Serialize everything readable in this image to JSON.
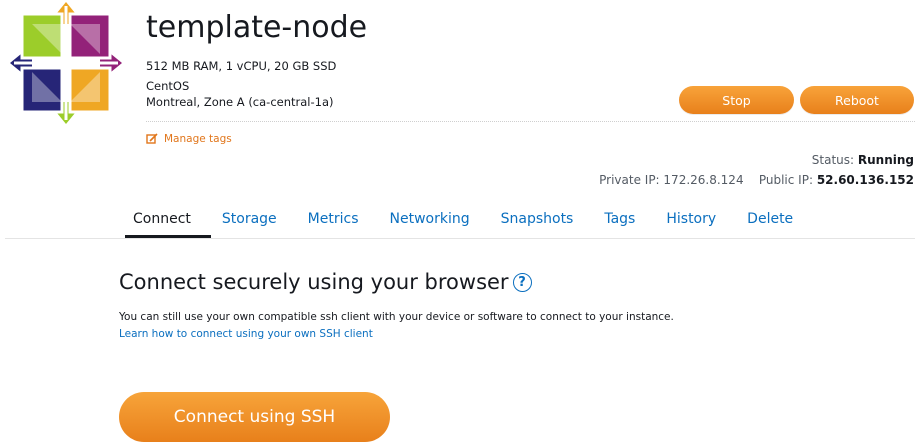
{
  "instance": {
    "name": "template-node",
    "specs": "512 MB RAM, 1 vCPU, 20 GB SSD",
    "os": "CentOS",
    "location": "Montreal, Zone A (ca-central-1a)"
  },
  "actions": {
    "stop_label": "Stop",
    "reboot_label": "Reboot"
  },
  "manage_tags": {
    "label": "Manage tags",
    "icon": "edit-icon"
  },
  "status": {
    "label": "Status:",
    "value": "Running",
    "private_ip_label": "Private IP:",
    "private_ip": "172.26.8.124",
    "public_ip_label": "Public IP:",
    "public_ip": "52.60.136.152"
  },
  "tabs": [
    {
      "label": "Connect",
      "active": true
    },
    {
      "label": "Storage"
    },
    {
      "label": "Metrics"
    },
    {
      "label": "Networking"
    },
    {
      "label": "Snapshots"
    },
    {
      "label": "Tags"
    },
    {
      "label": "History"
    },
    {
      "label": "Delete"
    }
  ],
  "connect": {
    "heading": "Connect securely using your browser",
    "help_icon": "question-circle-icon",
    "help_glyph": "?",
    "description": "You can still use your own compatible ssh client with your device or software to connect to your instance.",
    "learn_link": "Learn how to connect using your own SSH client",
    "ssh_button": "Connect using SSH"
  },
  "colors": {
    "accent_orange": "#ec8a25",
    "link_blue": "#0b6fbf",
    "text_dark": "#16191f"
  }
}
